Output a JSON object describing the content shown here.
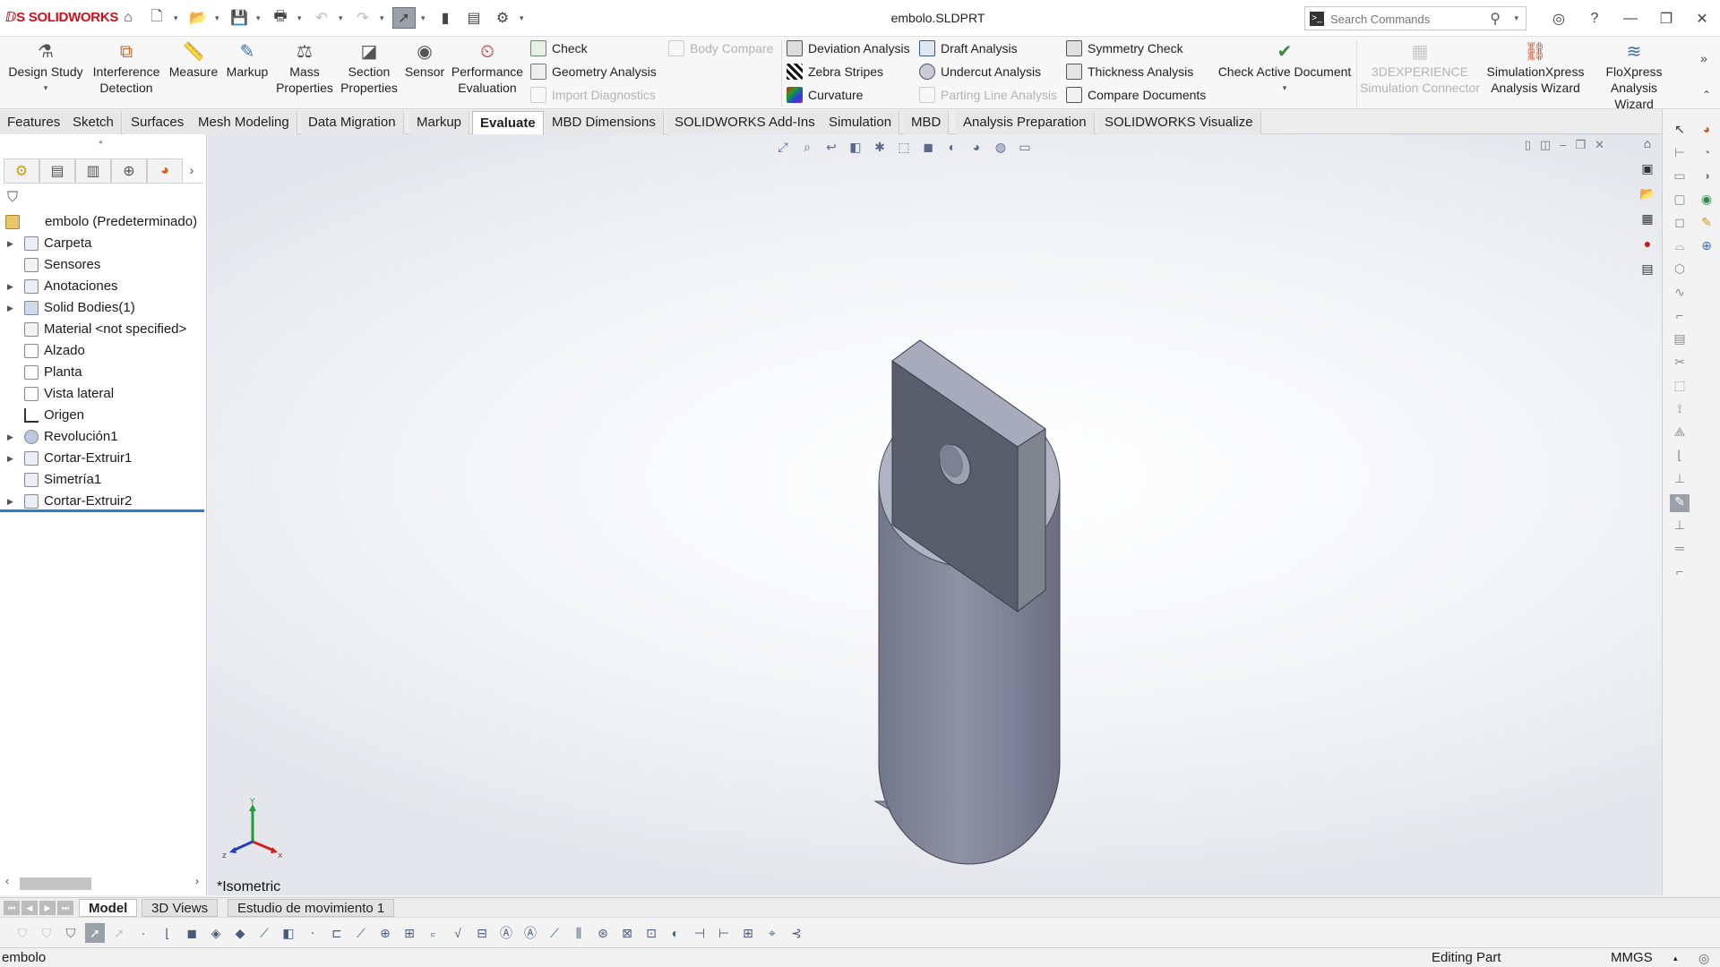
{
  "app": {
    "logo_text": "SOLIDWORKS",
    "document_title": "embolo.SLDPRT",
    "search_placeholder": "Search Commands"
  },
  "ribbon": {
    "big_buttons": [
      {
        "label": "Design Study",
        "icon": "design-study-icon"
      },
      {
        "label": "Interference Detection",
        "icon": "interference-detection-icon"
      },
      {
        "label": "Measure",
        "icon": "measure-icon"
      },
      {
        "label": "Markup",
        "icon": "markup-icon"
      },
      {
        "label": "Mass Properties",
        "icon": "mass-properties-icon"
      },
      {
        "label": "Section Properties",
        "icon": "section-properties-icon"
      },
      {
        "label": "Sensor",
        "icon": "sensor-icon"
      },
      {
        "label": "Performance Evaluation",
        "icon": "performance-evaluation-icon"
      }
    ],
    "col1": [
      {
        "label": "Check",
        "enabled": true
      },
      {
        "label": "Geometry Analysis",
        "enabled": true
      },
      {
        "label": "Import Diagnostics",
        "enabled": false
      }
    ],
    "col2": [
      {
        "label": "Body Compare",
        "enabled": false
      }
    ],
    "col3": [
      {
        "label": "Deviation Analysis",
        "enabled": true
      },
      {
        "label": "Zebra Stripes",
        "enabled": true
      },
      {
        "label": "Curvature",
        "enabled": true
      }
    ],
    "col4": [
      {
        "label": "Draft Analysis",
        "enabled": true
      },
      {
        "label": "Undercut Analysis",
        "enabled": true
      },
      {
        "label": "Parting Line Analysis",
        "enabled": false
      }
    ],
    "col5": [
      {
        "label": "Symmetry Check",
        "enabled": true
      },
      {
        "label": "Thickness Analysis",
        "enabled": true
      },
      {
        "label": "Compare Documents",
        "enabled": true
      }
    ],
    "check_active": "Check Active Document",
    "right_buttons": [
      {
        "label": "3DEXPERIENCE Simulation Connector",
        "enabled": false
      },
      {
        "label": "SimulationXpress Analysis Wizard",
        "enabled": true
      },
      {
        "label": "FloXpress Analysis Wizard",
        "enabled": true
      }
    ]
  },
  "command_tabs": [
    "Features",
    "Sketch",
    "Surfaces",
    "Mesh Modeling",
    "Data Migration",
    "Markup",
    "Evaluate",
    "MBD Dimensions",
    "SOLIDWORKS Add-Ins",
    "Simulation",
    "MBD",
    "Analysis Preparation",
    "SOLIDWORKS Visualize"
  ],
  "active_command_tab": "Evaluate",
  "feature_tree": {
    "root": "embolo  (Predeterminado)",
    "items": [
      {
        "label": "Carpeta",
        "expandable": true
      },
      {
        "label": "Sensores",
        "expandable": false
      },
      {
        "label": "Anotaciones",
        "expandable": true
      },
      {
        "label": "Solid Bodies(1)",
        "expandable": true
      },
      {
        "label": "Material <not specified>",
        "expandable": false
      },
      {
        "label": "Alzado",
        "expandable": false
      },
      {
        "label": "Planta",
        "expandable": false
      },
      {
        "label": "Vista lateral",
        "expandable": false
      },
      {
        "label": "Origen",
        "expandable": false
      },
      {
        "label": "Revolución1",
        "expandable": true
      },
      {
        "label": "Cortar-Extruir1",
        "expandable": true
      },
      {
        "label": "Simetría1",
        "expandable": false
      },
      {
        "label": "Cortar-Extruir2",
        "expandable": true
      }
    ]
  },
  "viewport": {
    "view_name": "*Isometric",
    "triad": {
      "x": "x",
      "y": "Y",
      "z": "z"
    },
    "part_color": "#8c8f9e"
  },
  "model_tabs": [
    "Model",
    "3D Views",
    "Estudio de movimiento 1"
  ],
  "active_model_tab": "Model",
  "status": {
    "left": "embolo",
    "mode": "Editing Part",
    "units": "MMGS"
  },
  "colors": {
    "accent": "#2a7fd4",
    "brand_red": "#d0101a"
  }
}
